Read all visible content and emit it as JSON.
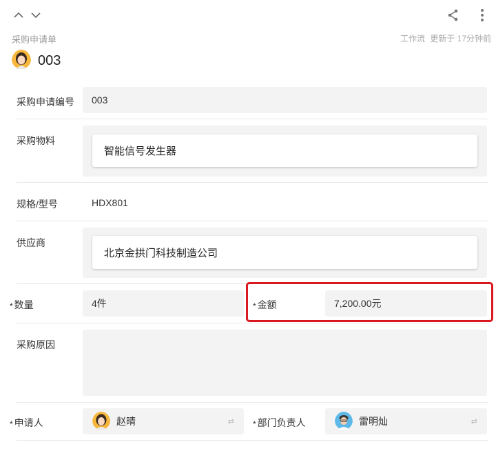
{
  "header": {
    "form_type": "采购申请单",
    "workflow_label": "工作流",
    "updated_text": "更新于 17分钟前",
    "title": "003"
  },
  "fields": {
    "purchase_no": {
      "label": "采购申请编号",
      "value": "003"
    },
    "material": {
      "label": "采购物料",
      "value": "智能信号发生器"
    },
    "spec": {
      "label": "规格/型号",
      "value": "HDX801"
    },
    "supplier": {
      "label": "供应商",
      "value": "北京金拱门科技制造公司"
    },
    "quantity": {
      "label": "数量",
      "value": "4件",
      "required_mark": "*"
    },
    "amount": {
      "label": "金额",
      "value": "7,200.00元",
      "required_mark": "*"
    },
    "reason": {
      "label": "采购原因",
      "value": ""
    },
    "applicant": {
      "label": "申请人",
      "value": "赵晴",
      "required_mark": "*",
      "swap_icon": "⇄"
    },
    "dept_head": {
      "label": "部门负责人",
      "value": "雷明灿",
      "required_mark": "*",
      "swap_icon": "⇄"
    }
  },
  "icons": {
    "chevron_up": "chevron-up-icon",
    "chevron_down": "chevron-down-icon",
    "share": "share-icon",
    "more": "more-vertical-icon"
  },
  "colors": {
    "highlight": "#d9181f",
    "field_bg": "#f3f3f3"
  }
}
